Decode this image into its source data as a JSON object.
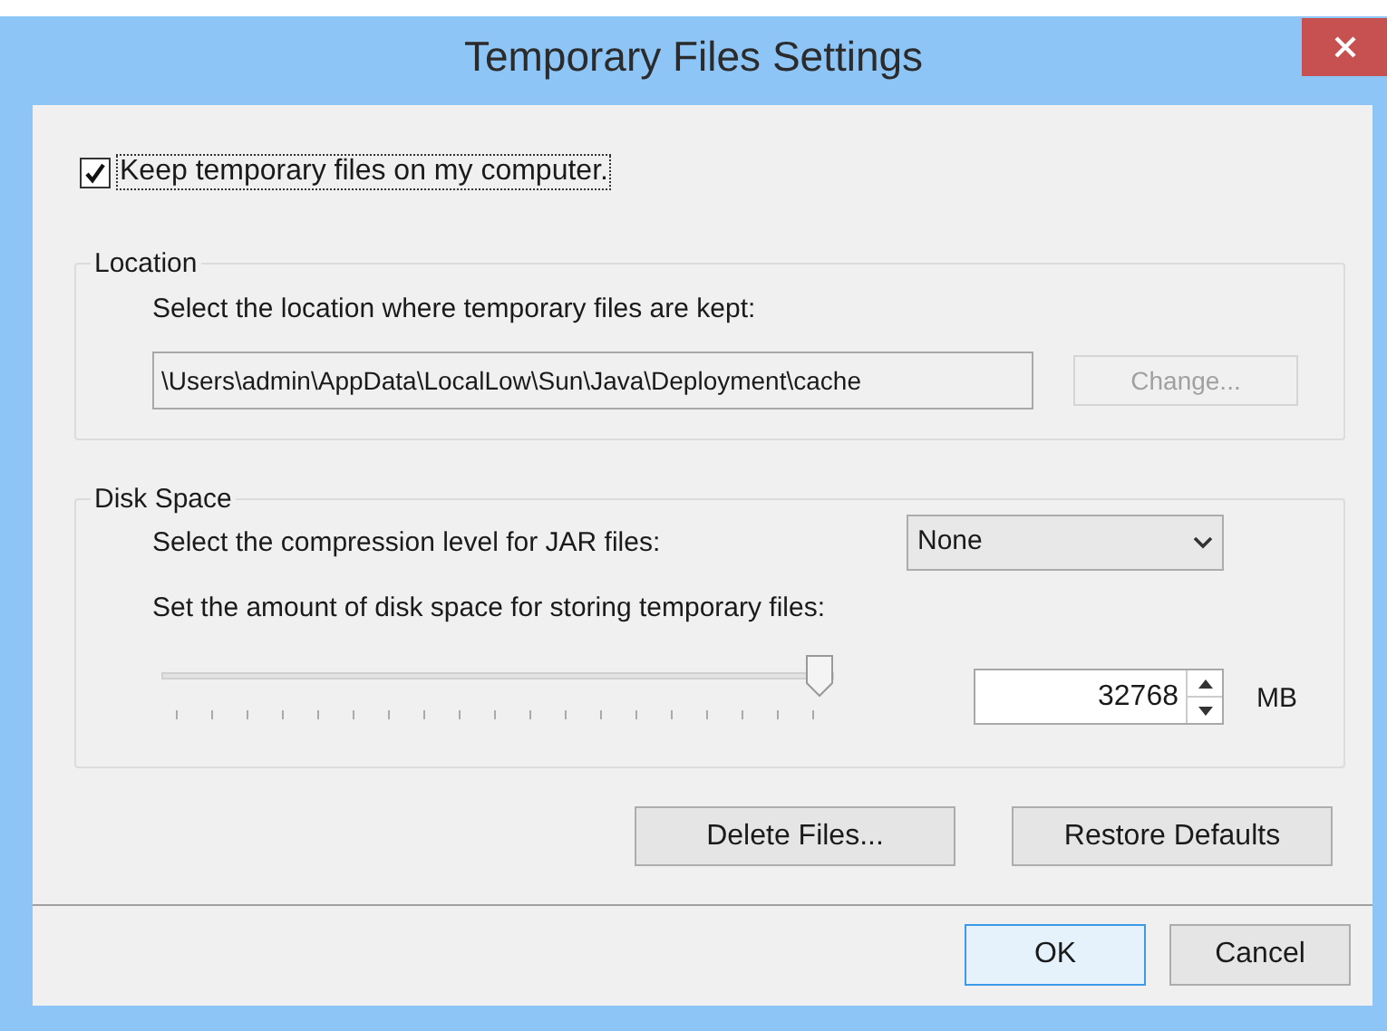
{
  "window": {
    "title": "Temporary Files Settings"
  },
  "keep_files": {
    "label": "Keep temporary files on my computer.",
    "checked": true
  },
  "location": {
    "legend": "Location",
    "prompt": "Select the location where temporary files are kept:",
    "path": "\\Users\\admin\\AppData\\LocalLow\\Sun\\Java\\Deployment\\cache",
    "change_button": {
      "label": "Change...",
      "disabled": true
    }
  },
  "disk_space": {
    "legend": "Disk Space",
    "compression_label": "Select the compression level for JAR files:",
    "compression_value": "None",
    "amount_label": "Set the amount of disk space for storing temporary files:",
    "slider": {
      "level": 1.0
    },
    "size_value": "32768",
    "unit": "MB"
  },
  "actions": [
    {
      "label": "Delete Files..."
    },
    {
      "label": "Restore Defaults"
    }
  ],
  "buttons": [
    {
      "label": "OK",
      "default": true
    },
    {
      "label": "Cancel",
      "default": false
    }
  ]
}
